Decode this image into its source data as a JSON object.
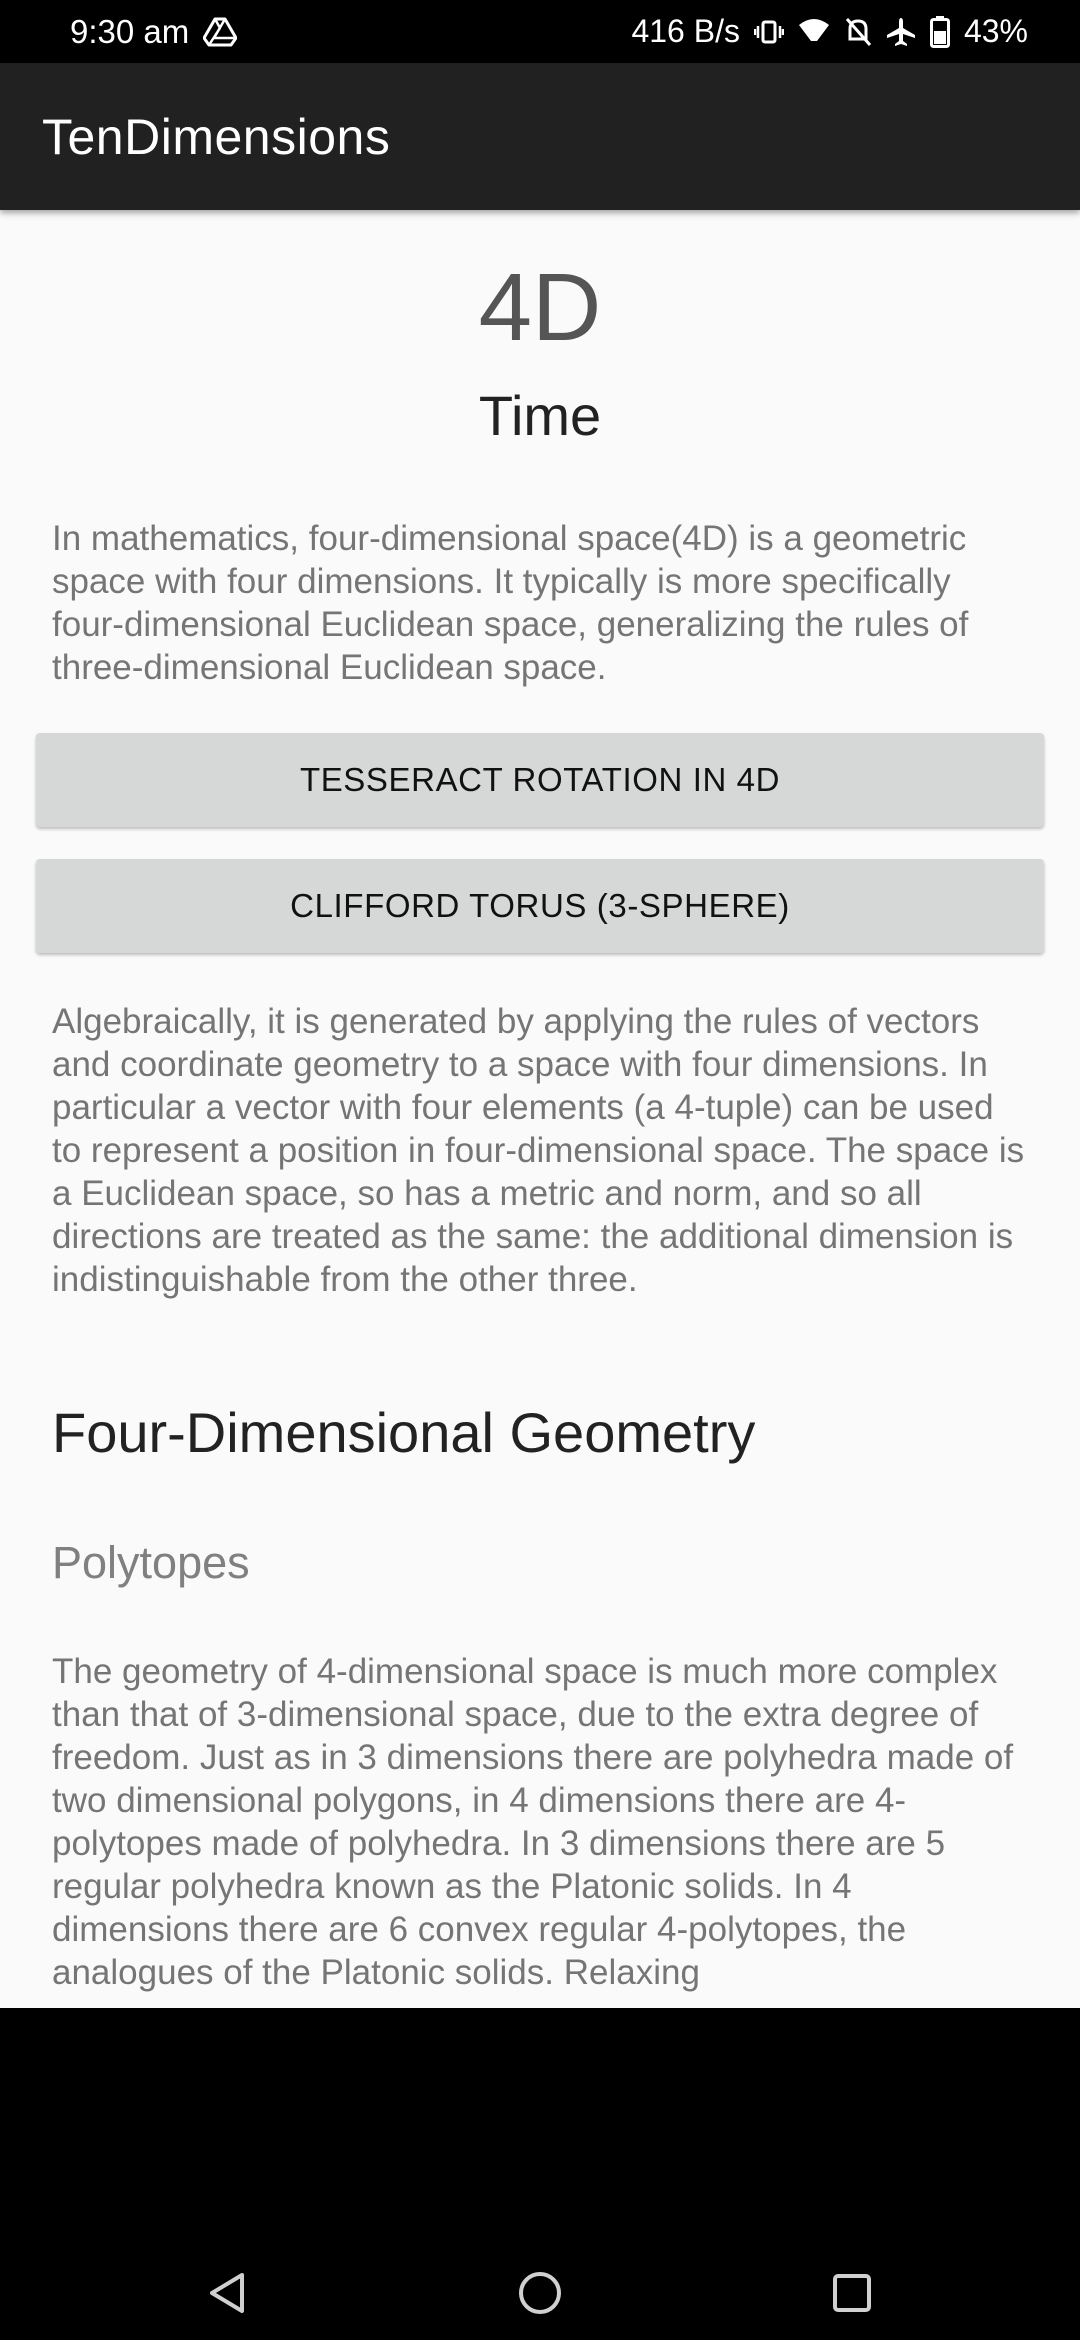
{
  "status_bar": {
    "time": "9:30 am",
    "network_speed": "416 B/s",
    "battery": "43%",
    "icons": [
      "drive-icon",
      "vibrate-icon",
      "wifi-icon",
      "no-notification-icon",
      "airplane-icon",
      "battery-icon"
    ]
  },
  "app_bar": {
    "title": "TenDimensions"
  },
  "main": {
    "dimension": "4D",
    "dimension_name": "Time",
    "intro": "In mathematics, four-dimensional space(4D) is a geometric space with four dimensions. It typically is more specifically four-dimensional Euclidean space, generalizing the rules of three-dimensional Euclidean space.",
    "buttons": {
      "tesseract": "TESSERACT ROTATION IN 4D",
      "clifford": "CLIFFORD TORUS (3-SPHERE)"
    },
    "algebra_paragraph": "Algebraically, it is generated by applying the rules of vectors and coordinate geometry to a space with four dimensions. In particular a vector with four elements (a 4-tuple) can be used to represent a position in four-dimensional space. The space is a Euclidean space, so has a metric and norm, and so all directions are treated as the same: the additional dimension is indistinguishable from the other three.",
    "section_title": "Four-Dimensional Geometry",
    "subsection_title": "Polytopes",
    "geometry_paragraph": "The geometry of 4-dimensional space is much more complex than that of 3-dimensional space, due to the extra degree of freedom.  Just as in 3 dimensions there are polyhedra made of two dimensional polygons, in 4 dimensions there are 4-polytopes made of polyhedra. In 3 dimensions there are 5 regular polyhedra known as the Platonic solids. In 4 dimensions there are 6 convex regular 4-polytopes, the analogues of the Platonic solids. Relaxing"
  },
  "nav_bar": {
    "buttons": [
      "back-icon",
      "home-icon",
      "recents-icon"
    ]
  }
}
